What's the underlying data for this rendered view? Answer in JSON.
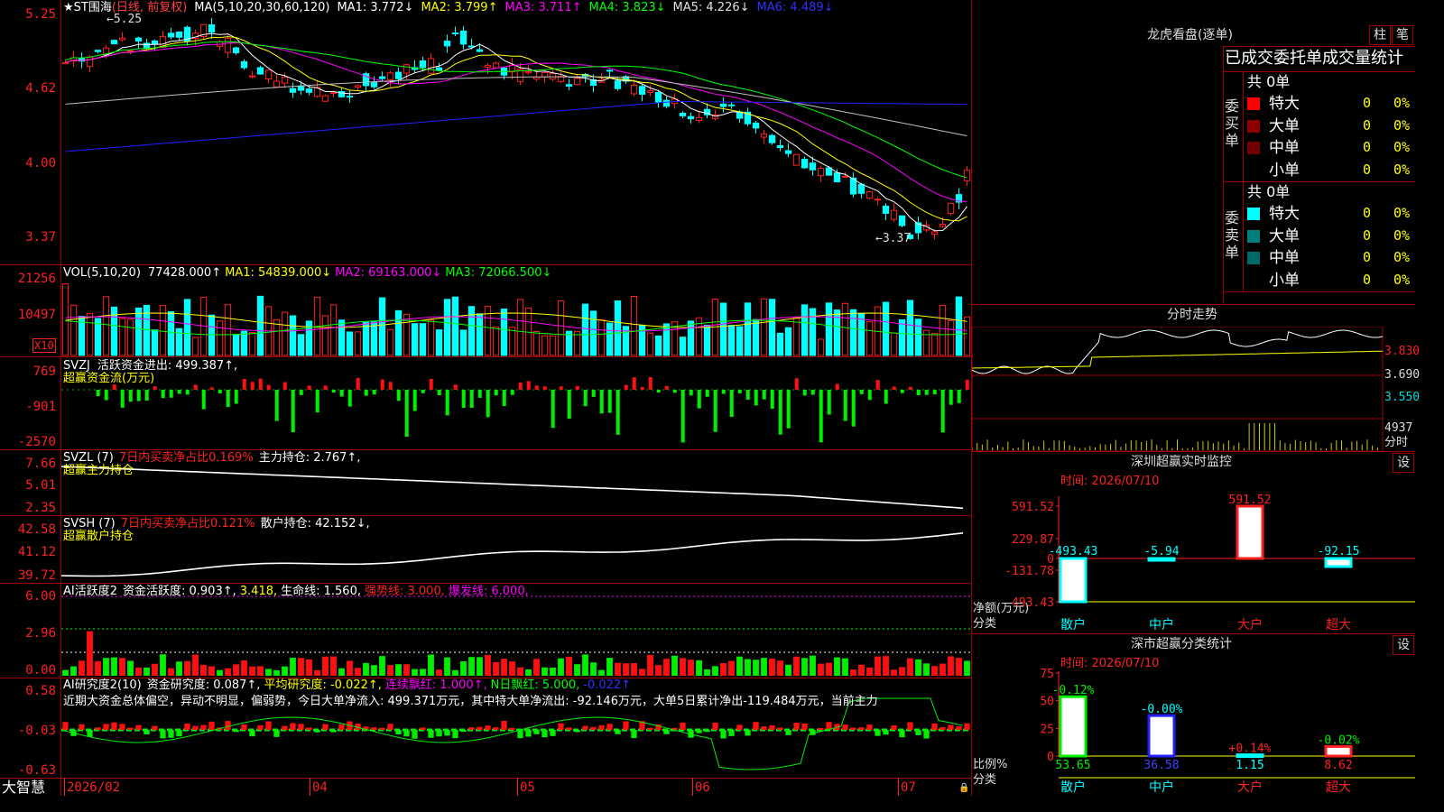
{
  "main": {
    "title": "★ST围海",
    "period": "(日线, 前复权)",
    "ma_label": "MA(5,10,20,30,60,120)",
    "ma1": "MA1: 3.772↓",
    "ma2": "MA2: 3.799↑",
    "ma3": "MA3: 3.711↑",
    "ma4": "MA4: 3.823↓",
    "ma5": "MA5: 4.226↓",
    "ma6": "MA6: 4.489↓",
    "high_mark": "5.25",
    "low_mark": "←3.37",
    "axis": [
      "5.25",
      "4.62",
      "4.00",
      "3.37"
    ]
  },
  "vol": {
    "label": "VOL(5,10,20)",
    "value": "77428.000↑",
    "ma1": "MA1: 54839.000↓",
    "ma2": "MA2: 69163.000↓",
    "ma3": "MA3: 72066.500↓",
    "axis": [
      "21256",
      "10497"
    ],
    "unit": "X10"
  },
  "svzj": {
    "label": "SVZJ",
    "text": "活跃资金进出: 499.387↑,",
    "sub": "超赢资金流(万元)",
    "axis": [
      "769",
      "-901",
      "-2570"
    ]
  },
  "svzl": {
    "label": "SVZL (7)",
    "ratio": "7日内买卖净占比0.169%",
    "hold": "主力持仓: 2.767↑,",
    "sub": "超赢主力持仓",
    "axis": [
      "7.66",
      "5.01",
      "2.35"
    ]
  },
  "svsh": {
    "label": "SVSH (7)",
    "ratio": "7日内买卖净占比0.121%",
    "hold": "散户持仓: 42.152↓,",
    "sub": "超赢散户持仓",
    "axis": [
      "42.58",
      "41.12",
      "39.72"
    ]
  },
  "ai1": {
    "label": "AI活跃度2",
    "a": "资金活跃度: 0.903↑,",
    "b": "3.418,",
    "c": "生命线: 1.560,",
    "d": "强势线: 3.000,",
    "e": "爆发线: 6.000,",
    "axis": [
      "6.00",
      "2.96",
      "0.00"
    ]
  },
  "ai2": {
    "label": "AI研究度2(10)",
    "a": "资金研究度: 0.087↑,",
    "b": "平均研究度: -0.022↑,",
    "c": "连续飘红: 1.000↑,",
    "d": "N日飘红: 5.000,",
    "e": "-0.022↑",
    "desc": "近期大资金总体偏空，异动不明显，偏弱势，今日大单净流入: 499.371万元，其中特大单净流出: -92.146万元，大单5日累计净出-119.484万元，当前主力",
    "axis": [
      "0.58",
      "-0.03",
      "-0.63"
    ]
  },
  "xaxis": {
    "brand": "大智慧",
    "dates": [
      "2026/02",
      "04",
      "05",
      "06",
      "07"
    ]
  },
  "dragon": {
    "title": "龙虎看盘(逐单)",
    "btn1": "柱",
    "btn2": "笔",
    "header": "已成交委托单成交量统计",
    "buy_side": "委买单",
    "sell_side": "委卖单",
    "buy_total": "共 0单",
    "sell_total": "共 0单",
    "buy_rows": [
      {
        "name": "特大",
        "count": "0",
        "pct": "0%",
        "color": "#ff0000"
      },
      {
        "name": "大单",
        "count": "0",
        "pct": "0%",
        "color": "#8b0000"
      },
      {
        "name": "中单",
        "count": "0",
        "pct": "0%",
        "color": "#700000"
      },
      {
        "name": "小单",
        "count": "0",
        "pct": "0%",
        "color": "#000000"
      }
    ],
    "sell_rows": [
      {
        "name": "特大",
        "count": "0",
        "pct": "0%",
        "color": "#00ffff"
      },
      {
        "name": "大单",
        "count": "0",
        "pct": "0%",
        "color": "#007f7f"
      },
      {
        "name": "中单",
        "count": "0",
        "pct": "0%",
        "color": "#006a6a"
      },
      {
        "name": "小单",
        "count": "0",
        "pct": "0%",
        "color": "#000000"
      }
    ]
  },
  "intraday": {
    "title": "分时走势",
    "axis": [
      "3.830",
      "3.690",
      "3.550"
    ],
    "vol_max": "4937",
    "vol_unit": "分时"
  },
  "sz_monitor": {
    "title": "深圳超赢实时监控",
    "btn": "设",
    "time": "时间: 2026/07/10",
    "axis": [
      "591.52",
      "229.87",
      "0",
      "-131.78",
      "-493.43"
    ],
    "ylabel": "净额(万元)",
    "xlabel": "分类",
    "cats": [
      "散户",
      "中户",
      "大户",
      "超大"
    ],
    "values": [
      "-493.43",
      "-5.94",
      "591.52",
      "-92.15"
    ]
  },
  "sz_class": {
    "title": "深市超赢分类统计",
    "btn": "设",
    "time": "时间: 2026/07/10",
    "axis": [
      "75",
      "50",
      "25",
      "0"
    ],
    "ylabel": "比例%",
    "xlabel": "分类",
    "cats": [
      "散户",
      "中户",
      "大户",
      "超大"
    ],
    "top": [
      "-0.12%",
      "-0.00%",
      "+0.14%",
      "-0.02%"
    ],
    "bottom": [
      "53.65",
      "36.58",
      "1.15",
      "8.62"
    ]
  },
  "colors": {
    "up": "#ff2020",
    "down": "#00ffff",
    "frame": "#a00000",
    "ma1": "#ffffff",
    "ma2": "#ffff00",
    "ma3": "#ff00ff",
    "ma4": "#00ff00",
    "ma5": "#c0c0c0",
    "ma6": "#2020ff"
  }
}
